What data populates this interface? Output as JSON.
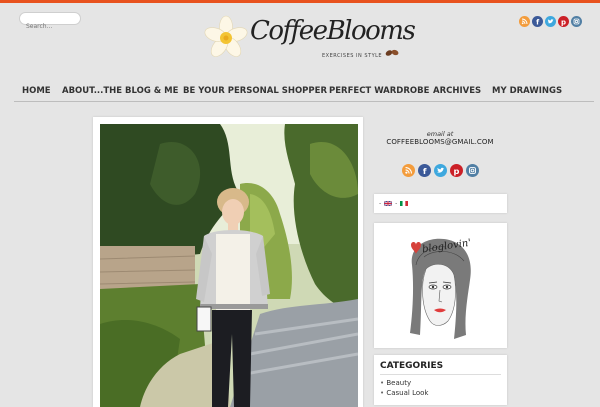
{
  "search": {
    "placeholder": "Search..."
  },
  "site": {
    "name": "CoffeeBlooms",
    "tagline": "EXERCISES IN STYLE"
  },
  "social_icons": [
    {
      "name": "rss",
      "color": "#f39c3c"
    },
    {
      "name": "facebook",
      "color": "#3b5998"
    },
    {
      "name": "twitter",
      "color": "#3ea8de"
    },
    {
      "name": "pinterest",
      "color": "#cb2027"
    },
    {
      "name": "instagram",
      "color": "#517fa4"
    }
  ],
  "nav": {
    "items": [
      "HOME",
      "ABOUT...THE BLOG & ME",
      "BE YOUR PERSONAL SHOPPER",
      "PERFECT WARDROBE",
      "ARCHIVES",
      "MY DRAWINGS"
    ]
  },
  "sidebar": {
    "email_label": "email at",
    "email_address": "COFFEEBLOOMS@GMAIL.COM",
    "language_separator": "-",
    "bloglovin_text": "bloglovin'",
    "categories": {
      "title": "CATEGORIES",
      "items": [
        "Beauty",
        "Casual Look"
      ]
    }
  },
  "colors": {
    "accent": "#e8521e",
    "background": "#e5e5e5"
  }
}
